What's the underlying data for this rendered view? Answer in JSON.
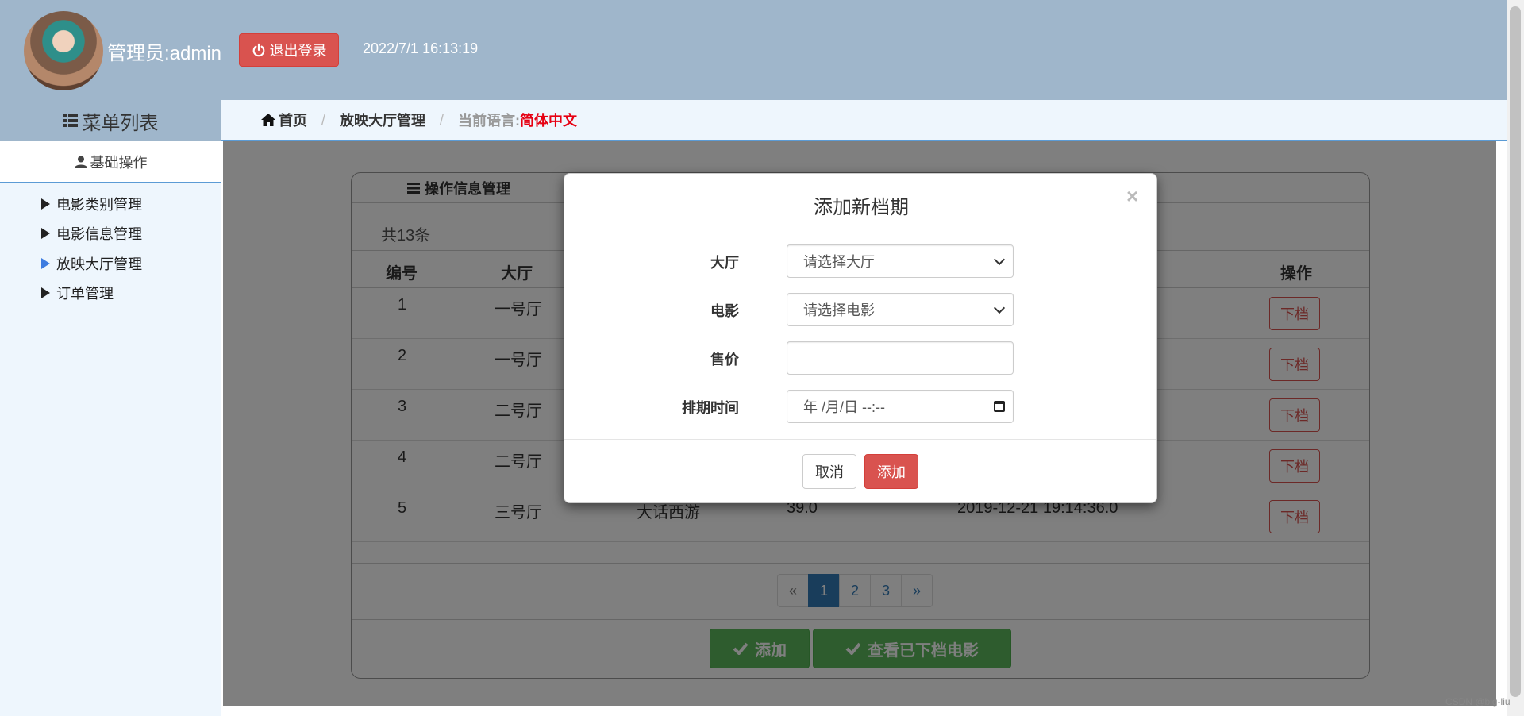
{
  "header": {
    "admin_label": "管理员:admin",
    "logout_label": "退出登录",
    "datetime": "2022/7/1 16:13:19"
  },
  "sidebar": {
    "menu_title": "菜单列表",
    "section_title": "基础操作",
    "items": [
      {
        "label": "电影类别管理",
        "active": false
      },
      {
        "label": "电影信息管理",
        "active": false
      },
      {
        "label": "放映大厅管理",
        "active": true
      },
      {
        "label": "订单管理",
        "active": false
      }
    ]
  },
  "breadcrumb": {
    "home": "首页",
    "current": "放映大厅管理",
    "lang_label": "当前语言:",
    "lang_value": "简体中文"
  },
  "panel": {
    "title": "操作信息管理",
    "total": "共13条",
    "columns": [
      "编号",
      "大厅",
      "操作"
    ],
    "rows": [
      {
        "id": "1",
        "hall": "一号厅",
        "movie": "",
        "price": "",
        "time": "",
        "action": "下档"
      },
      {
        "id": "2",
        "hall": "一号厅",
        "movie": "",
        "price": "",
        "time": "",
        "action": "下档"
      },
      {
        "id": "3",
        "hall": "二号厅",
        "movie": "",
        "price": "",
        "time": "",
        "action": "下档"
      },
      {
        "id": "4",
        "hall": "二号厅",
        "movie": "",
        "price": "",
        "time": "",
        "action": "下档"
      },
      {
        "id": "5",
        "hall": "三号厅",
        "movie": "大话西游",
        "price": "39.0",
        "time": "2019-12-21 19:14:36.0",
        "action": "下档"
      }
    ],
    "pagination": {
      "prev": "«",
      "pages": [
        "1",
        "2",
        "3"
      ],
      "current": "1",
      "next": "»"
    },
    "add_label": "添加",
    "view_removed_label": "查看已下档电影"
  },
  "modal": {
    "title": "添加新档期",
    "close": "×",
    "fields": {
      "hall_label": "大厅",
      "hall_value": "请选择大厅",
      "movie_label": "电影",
      "movie_value": "请选择电影",
      "price_label": "售价",
      "price_value": "",
      "time_label": "排期时间",
      "time_value": "年 /月/日 --:--"
    },
    "cancel_label": "取消",
    "add_label": "添加"
  },
  "watermark": "CSDN @big-liu",
  "colors": {
    "header_bg": "#9fb6cb",
    "danger": "#d9534f",
    "success": "#5cb85c",
    "primary": "#337ab7",
    "accent_blue": "#5b9bd5",
    "lang_red": "#e60012"
  }
}
